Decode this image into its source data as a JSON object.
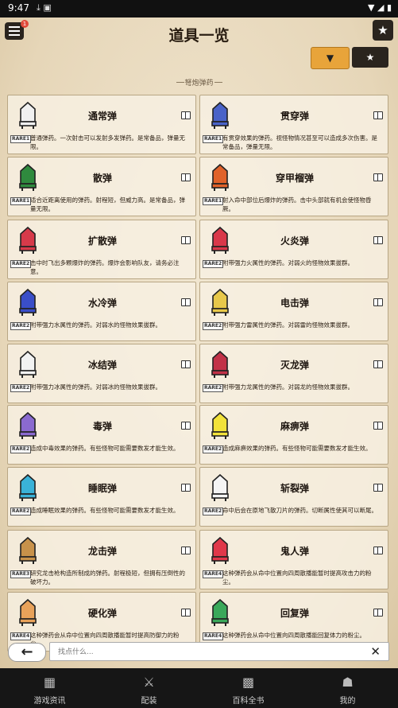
{
  "status": {
    "time": "9:47"
  },
  "header": {
    "title": "道具一览",
    "menu_badge": "1",
    "star_icon": "★",
    "filter_icon": "▼",
    "fav_icon": "★"
  },
  "section": {
    "label": "弩炮弹药"
  },
  "items": [
    {
      "name": "通常弹",
      "rare": "RARE1",
      "desc": "普通弹药。一次射击可以发射多发弹药。是常备品，弹量无限。",
      "color": "#f0f0f0"
    },
    {
      "name": "贯穿弹",
      "rare": "RARE1",
      "desc": "有贯穿效果的弹药。视怪物情况甚至可以造成多次伤害。是常备品，弹量无限。",
      "color": "#4a63c8"
    },
    {
      "name": "散弹",
      "rare": "RARE1",
      "desc": "适合近距离使用的弹药。射程短，但威力高。是常备品，弹量无限。",
      "color": "#2f8a3e"
    },
    {
      "name": "穿甲榴弹",
      "rare": "RARE1",
      "desc": "射入命中部位后爆炸的弹药。击中头部就有机会使怪物昏厥。",
      "color": "#e0622a"
    },
    {
      "name": "扩散弹",
      "rare": "RARE2",
      "desc": "击中时飞出多颗爆炸的弹药。爆炸会影响队友，请务必注意。",
      "color": "#d73a4a"
    },
    {
      "name": "火炎弹",
      "rare": "RARE2",
      "desc": "附带强力火属性的弹药。对弱火的怪物效果拔群。",
      "color": "#d9384a"
    },
    {
      "name": "水冷弹",
      "rare": "RARE2",
      "desc": "附带强力水属性的弹药。对弱水的怪物效果拔群。",
      "color": "#3a4ec8"
    },
    {
      "name": "电击弹",
      "rare": "RARE2",
      "desc": "附带强力雷属性的弹药。对弱雷的怪物效果拔群。",
      "color": "#e8c84a"
    },
    {
      "name": "冰结弹",
      "rare": "RARE2",
      "desc": "附带强力冰属性的弹药。对弱冰的怪物效果拔群。",
      "color": "#f2f2f2"
    },
    {
      "name": "灭龙弹",
      "rare": "RARE2",
      "desc": "附带强力龙属性的弹药。对弱龙的怪物效果拔群。",
      "color": "#c23248"
    },
    {
      "name": "毒弹",
      "rare": "RARE2",
      "desc": "造成中毒效果的弹药。有些怪物可能需要数发才能生效。",
      "color": "#8a6ad0"
    },
    {
      "name": "麻痹弹",
      "rare": "RARE2",
      "desc": "造成麻痹效果的弹药。有些怪物可能需要数发才能生效。",
      "color": "#f2e23a"
    },
    {
      "name": "睡眠弹",
      "rare": "RARE2",
      "desc": "造成睡眠效果的弹药。有些怪物可能需要数发才能生效。",
      "color": "#3ab2d8"
    },
    {
      "name": "斩裂弹",
      "rare": "RARE2",
      "desc": "命中后会在原地飞散刀片的弹药。切断属性使其可以断尾。",
      "color": "#f5f5f5"
    },
    {
      "name": "龙击弹",
      "rare": "RARE3",
      "desc": "研究龙击枪构造所制成的弹药。射程极短，但拥有压倒性的破坏力。",
      "color": "#c8924a"
    },
    {
      "name": "鬼人弹",
      "rare": "RARE4",
      "desc": "这种弹药会从命中位置向四周散播能暂时提高攻击力的粉尘。",
      "color": "#e0384a"
    },
    {
      "name": "硬化弹",
      "rare": "RARE4",
      "desc": "这种弹药会从命中位置向四周散播能暂时提高防御力的粉尘。",
      "color": "#e8a25a"
    },
    {
      "name": "回复弹",
      "rare": "RARE4",
      "desc": "这种弹药会从命中位置向四周散播能回复体力的粉尘。",
      "color": "#3aa85a"
    }
  ],
  "search": {
    "placeholder": "找点什么...",
    "back_icon": "←",
    "clear_icon": "✕"
  },
  "tabs": [
    {
      "label": "游戏资讯",
      "icon": "▦"
    },
    {
      "label": "配装",
      "icon": "⚔"
    },
    {
      "label": "百科全书",
      "icon": "▩"
    },
    {
      "label": "我的",
      "icon": "☗"
    }
  ]
}
